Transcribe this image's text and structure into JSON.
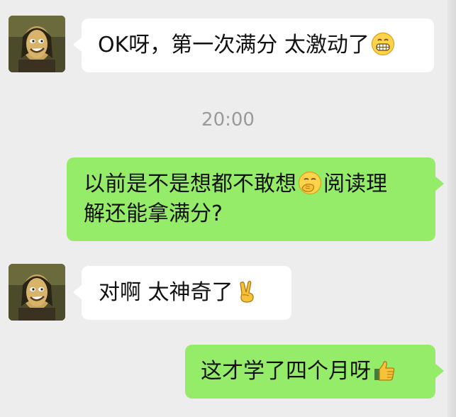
{
  "timestamp": "20:00",
  "messages": [
    {
      "id": "m1",
      "sender": "other",
      "text": "OK呀，第一次满分 太激动了",
      "trailing_emoji": "grin-face-emoji"
    },
    {
      "id": "m2",
      "sender": "self",
      "line1_before_emoji": "以前是不是想都不敢想",
      "inline_emoji": "hand-over-mouth-emoji",
      "line1_after_emoji": "阅读理",
      "line2": "解还能拿满分?"
    },
    {
      "id": "m3",
      "sender": "other",
      "text": "对啊 太神奇了",
      "trailing_emoji": "victory-hand-emoji"
    },
    {
      "id": "m4",
      "sender": "self",
      "text": "这才学了四个月呀",
      "trailing_emoji": "thumbs-up-emoji"
    }
  ],
  "colors": {
    "background": "#ededed",
    "incoming_bubble": "#ffffff",
    "outgoing_bubble": "#95ec69",
    "timestamp_text": "#9a9a9a"
  }
}
